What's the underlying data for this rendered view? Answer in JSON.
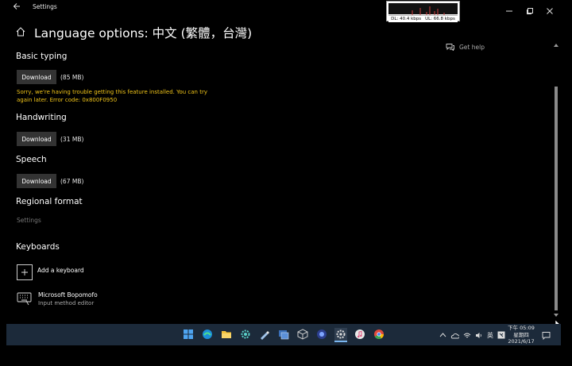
{
  "window": {
    "title": "Settings",
    "back_icon": "back-arrow-icon",
    "minimize_icon": "minimize-icon",
    "maximize_icon": "maximize-icon",
    "close_icon": "close-icon"
  },
  "netmeter": {
    "dl": "DL: 40.4 kbps",
    "ul": "UL: 66.8 kbps"
  },
  "page": {
    "home_icon": "home-icon",
    "title": "Language options: 中文 (繁體，台灣)"
  },
  "help": {
    "label": "Get help",
    "icon": "help-chat-icon"
  },
  "basic_typing": {
    "heading": "Basic typing",
    "button": "Download",
    "size": "(85 MB)",
    "error": "Sorry, we're having trouble getting this feature installed. You can try again later. Error code: 0x800F0950"
  },
  "handwriting": {
    "heading": "Handwriting",
    "button": "Download",
    "size": "(31 MB)"
  },
  "speech": {
    "heading": "Speech",
    "button": "Download",
    "size": "(67 MB)"
  },
  "regional": {
    "heading": "Regional format",
    "link": "Settings"
  },
  "keyboards": {
    "heading": "Keyboards",
    "add_label": "Add a keyboard",
    "items": [
      {
        "name": "Microsoft Bopomofo",
        "sub": "Input method editor",
        "icon": "keyboard-icon"
      }
    ]
  },
  "taskbar": {
    "icons": [
      "windows-start-icon",
      "edge-icon",
      "file-explorer-icon",
      "gear-app-icon",
      "paint-icon",
      "virtualbox-icon",
      "box-icon",
      "browser-icon",
      "settings-icon",
      "music-icon",
      "chrome-icon"
    ],
    "ime": "英",
    "time": "下午 05:09",
    "day": "星期四",
    "date": "2021/6/17"
  },
  "colors": {
    "error": "#f0c419",
    "taskbar": "#1c2a3a",
    "button": "#333333"
  }
}
